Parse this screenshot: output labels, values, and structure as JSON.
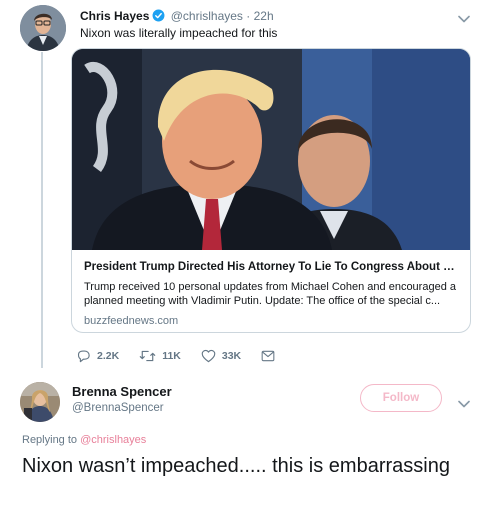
{
  "tweet": {
    "author_name": "Chris Hayes",
    "author_handle": "@chrislhayes",
    "separator": "·",
    "time": "22h",
    "text": "Nixon was literally impeached for this",
    "card": {
      "title": "President Trump Directed His Attorney To Lie To Congress About Th...",
      "description": "Trump received 10 personal updates from Michael Cohen and encouraged a planned meeting with Vladimir Putin. Update: The office of the special c...",
      "domain": "buzzfeednews.com"
    },
    "actions": {
      "replies": "2.2K",
      "retweets": "11K",
      "likes": "33K"
    }
  },
  "reply": {
    "author_name": "Brenna Spencer",
    "author_handle": "@BrennaSpencer",
    "follow_label": "Follow",
    "replying_prefix": "Replying to",
    "replying_mention": "@chrislhayes",
    "text": "Nixon wasn’t impeached..... this is embarrassing"
  },
  "colors": {
    "verified": "#1da1f2",
    "secondary_text": "#657786",
    "follow_accent": "#f4b8c8",
    "mention": "#e8809a",
    "thread_line": "#ccd6dd"
  },
  "icons": [
    "verified-badge-icon",
    "chevron-down-icon",
    "reply-icon",
    "retweet-icon",
    "like-icon",
    "direct-message-icon"
  ]
}
